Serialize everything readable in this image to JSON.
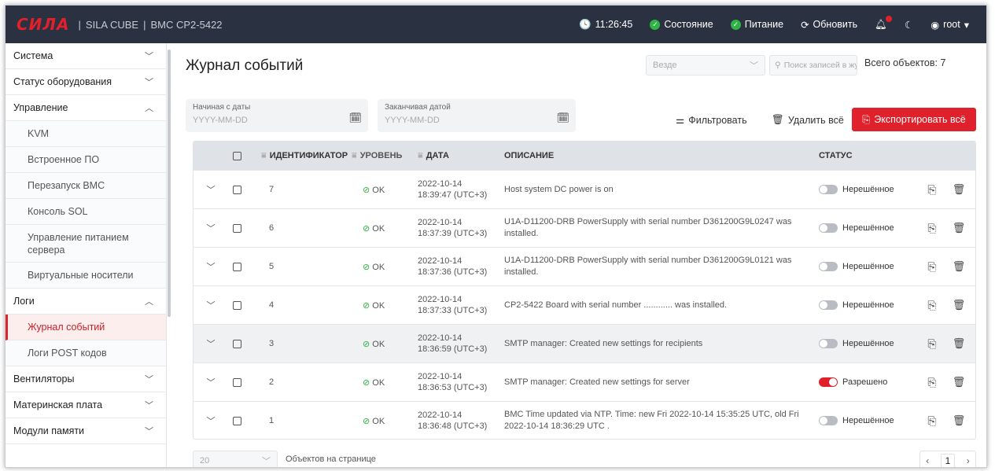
{
  "header": {
    "logo_text": "СИЛА",
    "product": "SILA CUBE",
    "device": "BMC CP2-5422",
    "time": "11:26:45",
    "status_label": "Состояние",
    "power_label": "Питание",
    "refresh_label": "Обновить",
    "user": "root",
    "accent_color": "#e0202a",
    "ok_color": "#2fb344"
  },
  "sidebar": {
    "items": [
      {
        "label": "Система"
      },
      {
        "label": "Статус оборудования"
      },
      {
        "label": "Управление"
      },
      {
        "label": "KVM"
      },
      {
        "label": "Встроенное ПО"
      },
      {
        "label": "Перезапуск BMC"
      },
      {
        "label": "Консоль SOL"
      },
      {
        "label": "Управление питанием сервера"
      },
      {
        "label": "Виртуальные носители"
      },
      {
        "label": "Логи"
      },
      {
        "label": "Журнал событий"
      },
      {
        "label": "Логи POST кодов"
      },
      {
        "label": "Вентиляторы"
      },
      {
        "label": "Материнская плата"
      },
      {
        "label": "Модули памяти"
      }
    ]
  },
  "main": {
    "title": "Журнал событий",
    "scope_select": "Везде",
    "search_placeholder": "Поиск записей в жур",
    "total_label": "Всего объектов: 7",
    "from_date_label": "Начиная с даты",
    "to_date_label": "Заканчивая датой",
    "date_placeholder": "YYYY-MM-DD",
    "filter_label": "Фильтровать",
    "delete_all_label": "Удалить всё",
    "export_all_label": "Экспортировать всё"
  },
  "table": {
    "columns": [
      "ИДЕНТИФИКАТОР",
      "УРОВЕНЬ",
      "ДАТА",
      "ОПИСАНИЕ",
      "СТАТУС"
    ],
    "rows": [
      {
        "id": "7",
        "level": "OK",
        "date": "2022-10-14",
        "time": "18:39:47 (UTC+3)",
        "desc": "Host system DC power is on",
        "status": "Нерешённое",
        "resolved": false
      },
      {
        "id": "6",
        "level": "OK",
        "date": "2022-10-14",
        "time": "18:37:39 (UTC+3)",
        "desc": "U1A-D11200-DRB PowerSupply with serial number D361200G9L0247 was installed.",
        "status": "Нерешённое",
        "resolved": false
      },
      {
        "id": "5",
        "level": "OK",
        "date": "2022-10-14",
        "time": "18:37:36 (UTC+3)",
        "desc": "U1A-D11200-DRB PowerSupply with serial number D361200G9L0121 was installed.",
        "status": "Нерешённое",
        "resolved": false
      },
      {
        "id": "4",
        "level": "OK",
        "date": "2022-10-14",
        "time": "18:37:33 (UTC+3)",
        "desc": "CP2-5422 Board with serial number ............ was installed.",
        "status": "Нерешённое",
        "resolved": false
      },
      {
        "id": "3",
        "level": "OK",
        "date": "2022-10-14",
        "time": "18:36:59 (UTC+3)",
        "desc": "SMTP manager: Created new settings for recipients",
        "status": "Нерешённое",
        "resolved": false
      },
      {
        "id": "2",
        "level": "OK",
        "date": "2022-10-14",
        "time": "18:36:53 (UTC+3)",
        "desc": "SMTP manager: Created new settings for server",
        "status": "Разрешено",
        "resolved": true
      },
      {
        "id": "1",
        "level": "OK",
        "date": "2022-10-14",
        "time": "18:36:48 (UTC+3)",
        "desc": "BMC Time updated via NTP. Time: new Fri 2022-10-14 15:35:25 UTC, old Fri 2022-10-14 18:36:29 UTC .",
        "status": "Нерешённое",
        "resolved": false
      }
    ]
  },
  "footer": {
    "per_page": "20",
    "per_page_label": "Объектов на странице",
    "page": "1"
  }
}
